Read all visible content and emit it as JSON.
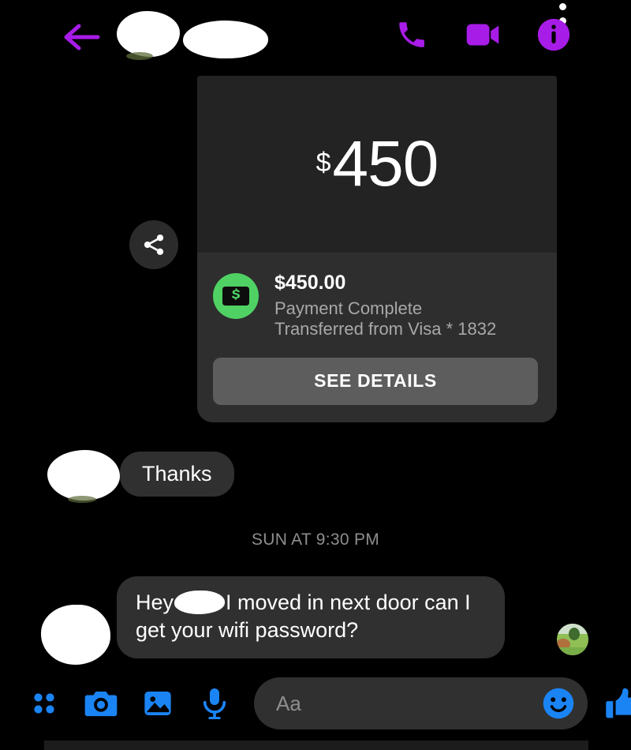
{
  "app": {
    "theme": "dark",
    "background_color": "#000000",
    "accent_purple": "#a81ce8",
    "accent_blue": "#1b84f5",
    "money_green": "#4fd263",
    "bubble_gray": "#303030"
  },
  "header": {
    "back_label": "Back",
    "contact_name_redacted": "",
    "avatar_redacted": "",
    "icons": {
      "call": "phone-icon",
      "video": "video-camera-icon",
      "info": "info-icon",
      "overflow": "kebab-menu-icon"
    }
  },
  "payment_card": {
    "share_icon": "share-icon",
    "hero_currency": "$",
    "hero_amount": "450",
    "badge_icon": "money-bill-icon",
    "amount": "$450.00",
    "status": "Payment Complete",
    "source": "Transferred from Visa * 1832",
    "details_button": "SEE DETAILS"
  },
  "messages": [
    {
      "id": "thanks",
      "sender": "them",
      "text": "Thanks"
    },
    {
      "id": "wifi",
      "sender": "them",
      "text_before": "Hey",
      "text_after": "I moved in next door can I get your wifi password?",
      "redacted_name": ""
    }
  ],
  "timestamp": "SUN AT 9:30 PM",
  "seen_indicator": {
    "label": "Seen"
  },
  "composer": {
    "placeholder": "Aa",
    "value": "",
    "icons": {
      "apps": "grid-dots-icon",
      "camera": "camera-icon",
      "gallery": "photo-icon",
      "mic": "microphone-icon",
      "emoji": "smiley-icon",
      "like": "thumbs-up-icon"
    }
  }
}
